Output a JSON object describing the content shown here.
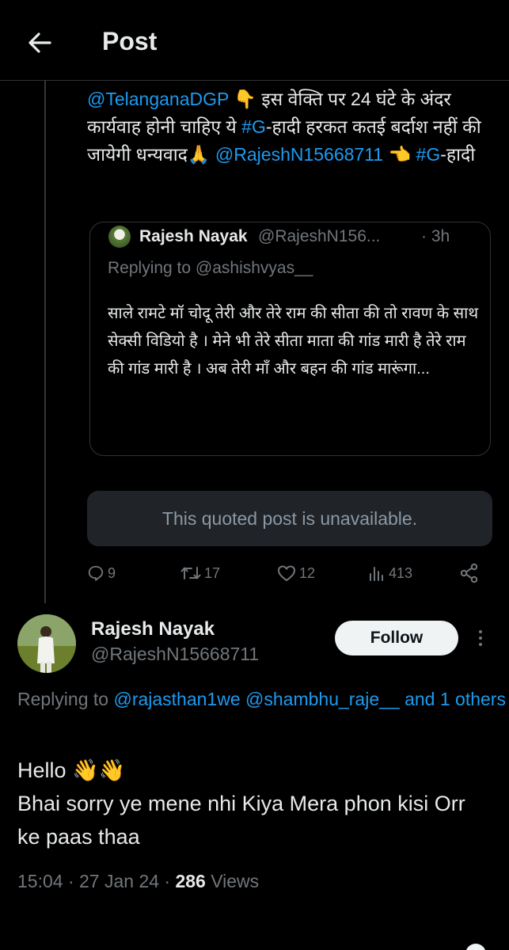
{
  "header": {
    "title": "Post"
  },
  "tweet": {
    "mention_dgp": "@TelanganaDGP",
    "emoji_point": "👇",
    "text_part1": " इस वेक्ति पर 24 घंटे के अंदर कार्यवाह होनी चाहिए ये ",
    "hashtag": "#G",
    "text_part2": "-हादी हरकत कतई बर्दाश नहीं की जायेगी धन्यवाद🙏",
    "mention_rajesh": "@RajeshN15668711",
    "emoji_hand": " 👈 ",
    "hashtag2": "#G",
    "text_part3": "-हादी"
  },
  "quote": {
    "name": "Rajesh Nayak",
    "handle": "@RajeshN156...",
    "time": "· 3h",
    "replying": "Replying to @ashishvyas__",
    "body": "साले रामटे मॉ चोदू तेरी और तेरे राम की सीता की तो रावण के साथ सेक्सी विडियो है । मेने भी तेरे सीता माता की गांड मारी है तेरे राम की गांड मारी है । अब तेरी माँ और बहन की गांड मारूंगा..."
  },
  "unavailable_text": "This quoted post is unavailable.",
  "actions": {
    "replies": "9",
    "reposts": "17",
    "likes": "12",
    "views": "413"
  },
  "reply": {
    "name": "Rajesh Nayak",
    "handle": "@RajeshN15668711",
    "follow_label": "Follow",
    "replying_prefix": "Replying to ",
    "replying_users": "@rajasthan1we @shambhu_raje__ and 1 others",
    "line1": "Hello 👋👋",
    "line2": "Bhai sorry ye mene nhi Kiya Mera phon kisi Orr ke paas thaa",
    "time": "15:04 · 27 Jan 24 · ",
    "views_count": "286",
    "views_label": " Views"
  },
  "icons": {
    "back": "arrow-left-icon",
    "reply": "speech-bubble-icon",
    "repost": "repost-arrows-icon",
    "like": "heart-icon",
    "views": "bar-chart-icon",
    "share": "share-icon",
    "more": "vertical-dots-icon"
  },
  "colors": {
    "accent": "#1d9bf0",
    "background": "#000000",
    "muted": "#71767b"
  }
}
